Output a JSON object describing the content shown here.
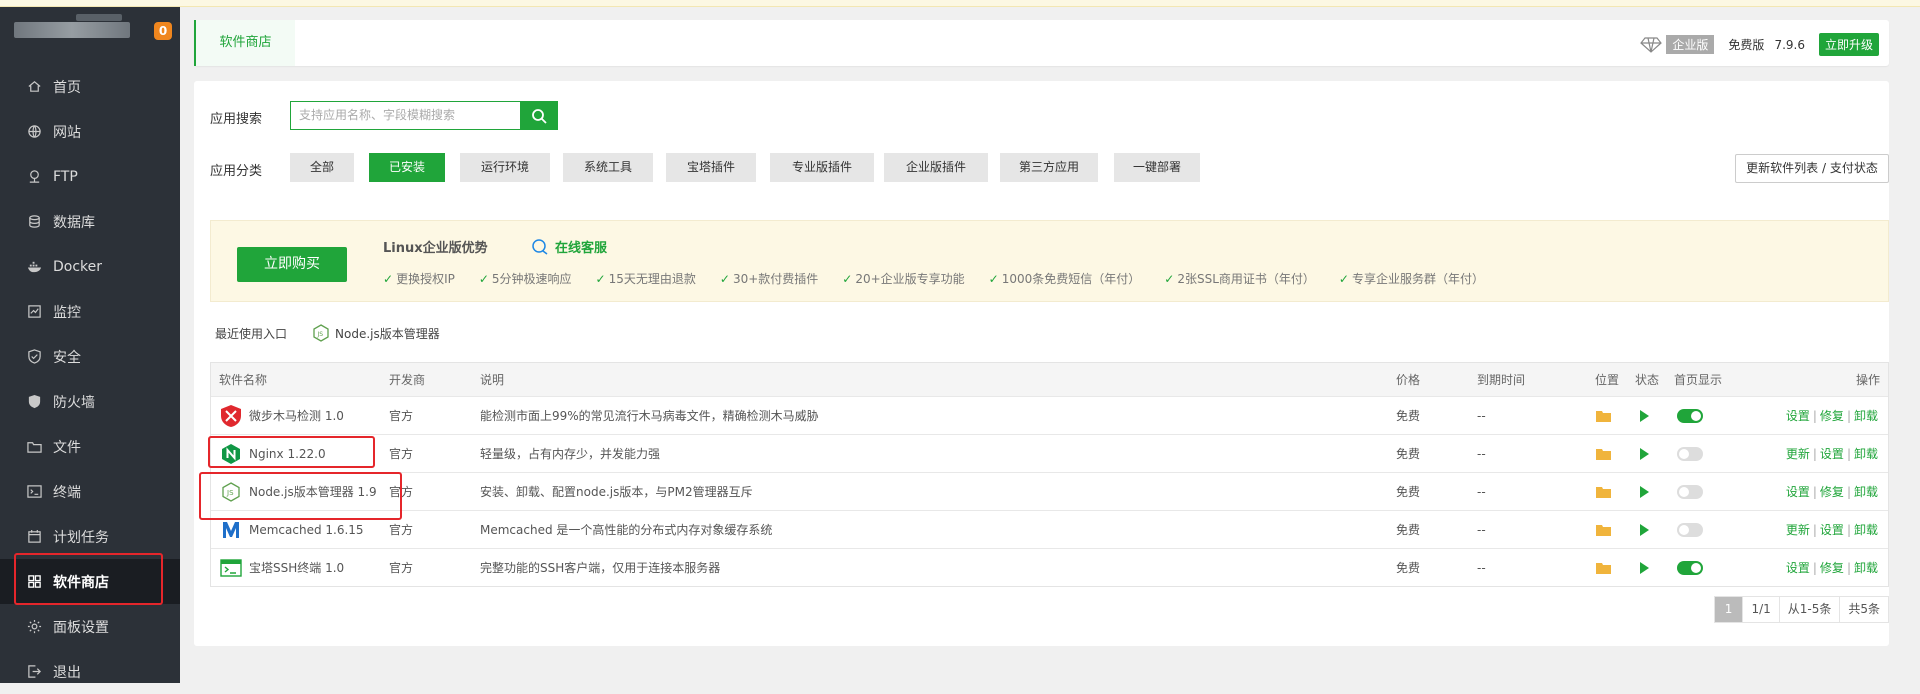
{
  "sidebar": {
    "badge": "0",
    "items": [
      {
        "label": "首页",
        "icon": "home-icon"
      },
      {
        "label": "网站",
        "icon": "globe-icon"
      },
      {
        "label": "FTP",
        "icon": "ftp-icon"
      },
      {
        "label": "数据库",
        "icon": "database-icon"
      },
      {
        "label": "Docker",
        "icon": "docker-icon"
      },
      {
        "label": "监控",
        "icon": "monitor-icon"
      },
      {
        "label": "安全",
        "icon": "shield-icon"
      },
      {
        "label": "防火墙",
        "icon": "firewall-icon"
      },
      {
        "label": "文件",
        "icon": "folder-icon"
      },
      {
        "label": "终端",
        "icon": "terminal-icon"
      },
      {
        "label": "计划任务",
        "icon": "calendar-icon"
      },
      {
        "label": "软件商店",
        "icon": "grid-icon",
        "active": true
      },
      {
        "label": "面板设置",
        "icon": "gear-icon"
      },
      {
        "label": "退出",
        "icon": "logout-icon"
      }
    ]
  },
  "header": {
    "tab": "软件商店",
    "enterprise_badge": "企业版",
    "edition": "免费版",
    "version": "7.9.6",
    "upgrade": "立即升级"
  },
  "search": {
    "label": "应用搜索",
    "placeholder": "支持应用名称、字段模糊搜索"
  },
  "categories": {
    "label": "应用分类",
    "items": [
      "全部",
      "已安装",
      "运行环境",
      "系统工具",
      "宝塔插件",
      "专业版插件",
      "企业版插件",
      "第三方应用",
      "一键部署"
    ],
    "selected": "已安装"
  },
  "refresh_button": "更新软件列表 / 支付状态",
  "promo": {
    "buy": "立即购买",
    "title": "Linux企业版优势",
    "service": "在线客服",
    "features": [
      "更换授权IP",
      "5分钟极速响应",
      "15天无理由退款",
      "30+款付费插件",
      "20+企业版专享功能",
      "1000条免费短信（年付）",
      "2张SSL商用证书（年付）",
      "专享企业服务群（年付）"
    ]
  },
  "recent": {
    "label": "最近使用入口",
    "item": "Node.js版本管理器"
  },
  "table": {
    "headers": {
      "name": "软件名称",
      "dev": "开发商",
      "desc": "说明",
      "price": "价格",
      "expire": "到期时间",
      "location": "位置",
      "status": "状态",
      "home": "首页显示",
      "ops": "操作"
    },
    "rows": [
      {
        "name": "微步木马检测 1.0",
        "dev": "官方",
        "desc": "能检测市面上99%的常见流行木马病毒文件，精确检测木马威胁",
        "price": "免费",
        "expire": "--",
        "home": true,
        "ops": [
          "设置",
          "修复",
          "卸载"
        ],
        "icon": "shield-red-icon"
      },
      {
        "name": "Nginx 1.22.0",
        "dev": "官方",
        "desc": "轻量级，占有内存少，并发能力强",
        "price": "免费",
        "expire": "--",
        "home": false,
        "ops": [
          "更新",
          "设置",
          "卸载"
        ],
        "icon": "nginx-icon"
      },
      {
        "name": "Node.js版本管理器 1.9",
        "dev": "官方",
        "desc": "安装、卸载、配置node.js版本，与PM2管理器互斥",
        "price": "免费",
        "expire": "--",
        "home": false,
        "ops": [
          "设置",
          "修复",
          "卸载"
        ],
        "icon": "nodejs-icon"
      },
      {
        "name": "Memcached 1.6.15",
        "dev": "官方",
        "desc": "Memcached 是一个高性能的分布式内存对象缓存系统",
        "price": "免费",
        "expire": "--",
        "home": false,
        "ops": [
          "更新",
          "设置",
          "卸载"
        ],
        "icon": "memcached-icon"
      },
      {
        "name": "宝塔SSH终端 1.0",
        "dev": "官方",
        "desc": "完整功能的SSH客户端，仅用于连接本服务器",
        "price": "免费",
        "expire": "--",
        "home": true,
        "ops": [
          "设置",
          "修复",
          "卸载"
        ],
        "icon": "ssh-terminal-icon"
      }
    ]
  },
  "pager": {
    "current": "1",
    "pages": "1/1",
    "range": "从1-5条",
    "total": "共5条"
  },
  "colors": {
    "accent": "#20a53a",
    "sidebar": "#2c3138",
    "highlight": "#e5262b"
  }
}
